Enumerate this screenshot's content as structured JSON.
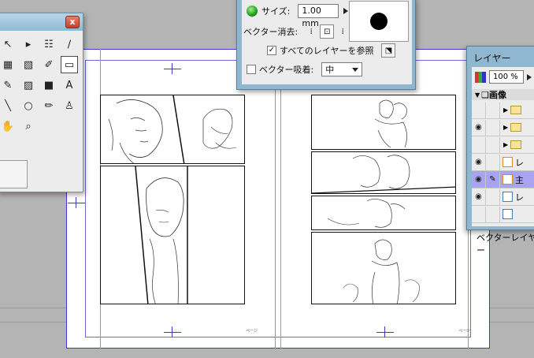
{
  "tool_palette": {
    "close_label": "x",
    "tools": [
      {
        "name": "move-icon",
        "glyph": "↖"
      },
      {
        "name": "selection-icon",
        "glyph": "▸"
      },
      {
        "name": "stack-icon",
        "glyph": "☷"
      },
      {
        "name": "eyedropper-icon",
        "glyph": "∕"
      },
      {
        "name": "grid-icon",
        "glyph": "▦"
      },
      {
        "name": "cube-icon",
        "glyph": "▧"
      },
      {
        "name": "pen-icon",
        "glyph": "✐"
      },
      {
        "name": "eraser-icon",
        "glyph": "▭"
      },
      {
        "name": "brush-icon",
        "glyph": "✎"
      },
      {
        "name": "fill-icon",
        "glyph": "▨"
      },
      {
        "name": "gradient-icon",
        "glyph": "■"
      },
      {
        "name": "text-icon",
        "glyph": "A"
      },
      {
        "name": "line-icon",
        "glyph": "╲"
      },
      {
        "name": "ellipse-icon",
        "glyph": "○"
      },
      {
        "name": "pencil-icon",
        "glyph": "✏"
      },
      {
        "name": "stamp-icon",
        "glyph": "♙"
      },
      {
        "name": "hand-icon",
        "glyph": "✋"
      },
      {
        "name": "zoom-icon",
        "glyph": "⌕"
      }
    ]
  },
  "sub_tool": {
    "size_label": "サイズ:",
    "size_value": "1.00 mm",
    "vector_erase_label": "ベクター消去:",
    "reference_all_label": "すべてのレイヤーを参照",
    "reference_all_checked": true,
    "vector_snap_label": "ベクター吸着:",
    "vector_snap_checked": false,
    "snap_option": "中"
  },
  "layers": {
    "title": "レイヤー",
    "opacity": "100 %",
    "group_name": "画像",
    "rows": [
      {
        "visible": false,
        "kind": "folder",
        "label": ""
      },
      {
        "visible": true,
        "kind": "folder",
        "label": ""
      },
      {
        "visible": false,
        "kind": "folder",
        "label": ""
      },
      {
        "visible": true,
        "kind": "layer-orange",
        "label": "レ"
      },
      {
        "visible": true,
        "kind": "layer-orange",
        "label": "主",
        "selected": true
      },
      {
        "visible": true,
        "kind": "layer",
        "label": "レ"
      },
      {
        "visible": false,
        "kind": "layer",
        "label": ""
      }
    ],
    "status": "ベクターレイヤー"
  },
  "pages": {
    "left_page_label": "ページ",
    "right_page_label": "ページ"
  }
}
